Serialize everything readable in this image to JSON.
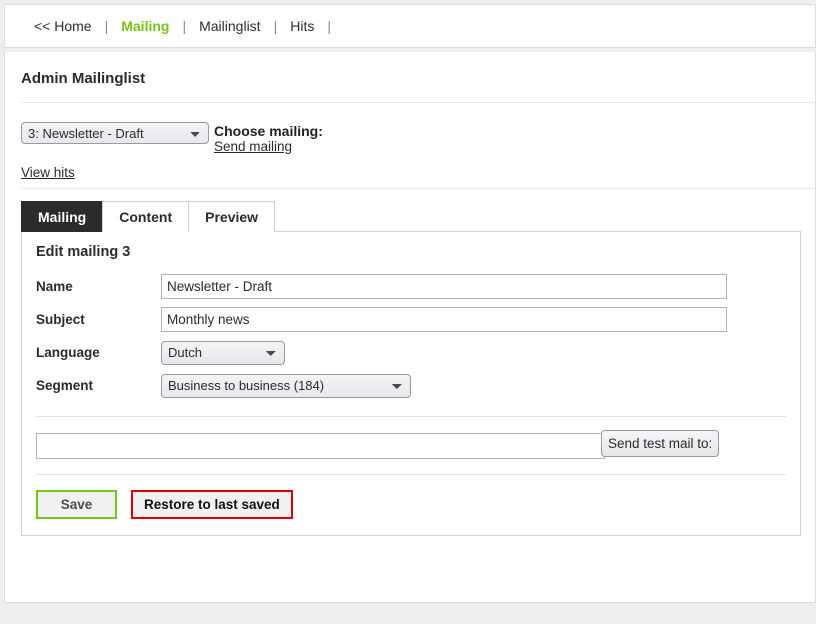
{
  "nav": {
    "separator": "|",
    "items": [
      {
        "label": "<< Home",
        "active": false
      },
      {
        "label": "Mailing",
        "active": true
      },
      {
        "label": "Mailinglist",
        "active": false
      },
      {
        "label": "Hits",
        "active": false
      }
    ],
    "active_color": "#76c714"
  },
  "page": {
    "title": "Admin Mailinglist"
  },
  "chooser": {
    "mailing_selected": "3: Newsletter - Draft",
    "mailing_options": [
      "3: Newsletter - Draft"
    ],
    "choose_label": "Choose mailing:",
    "send_mailing_label": "Send mailing",
    "view_hits_label": "View hits"
  },
  "tabs": [
    {
      "label": "Mailing",
      "active": true
    },
    {
      "label": "Content",
      "active": false
    },
    {
      "label": "Preview",
      "active": false
    }
  ],
  "form": {
    "heading": "Edit mailing 3",
    "fields": {
      "name": {
        "label": "Name",
        "value": "Newsletter - Draft",
        "placeholder": ""
      },
      "subject": {
        "label": "Subject",
        "value": "Monthly news",
        "placeholder": ""
      },
      "language": {
        "label": "Language",
        "value": "Dutch",
        "options": [
          "Dutch"
        ]
      },
      "segment": {
        "label": "Segment",
        "value": "Business to business (184)",
        "options": [
          "Business to business (184)"
        ]
      }
    }
  },
  "testmail": {
    "value": "",
    "placeholder": "",
    "button_label": "Send test mail to:"
  },
  "actions": {
    "save_label": "Save",
    "save_border_color": "#76c714",
    "restore_label": "Restore to last saved",
    "restore_border_color": "#e00000"
  }
}
